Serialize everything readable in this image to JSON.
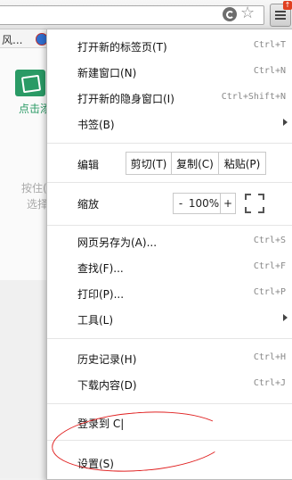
{
  "toolbar": {
    "badge": "↑"
  },
  "bookmarks": {
    "first": "风..."
  },
  "page": {
    "app_label": "点击添",
    "hint_line1": "按住(",
    "hint_line2": "选择"
  },
  "menu": {
    "new_tab": {
      "label": "打开新的标签页(T)",
      "shortcut": "Ctrl+T"
    },
    "new_window": {
      "label": "新建窗口(N)",
      "shortcut": "Ctrl+N"
    },
    "incognito": {
      "label": "打开新的隐身窗口(I)",
      "shortcut": "Ctrl+Shift+N"
    },
    "bookmarks": {
      "label": "书签(B)"
    },
    "edit": {
      "label": "编辑",
      "cut": "剪切(T)",
      "copy": "复制(C)",
      "paste": "粘贴(P)"
    },
    "zoom": {
      "label": "缩放",
      "minus": "-",
      "value": "100%",
      "plus": "+"
    },
    "save_as": {
      "label": "网页另存为(A)...",
      "shortcut": "Ctrl+S"
    },
    "find": {
      "label": "查找(F)...",
      "shortcut": "Ctrl+F"
    },
    "print": {
      "label": "打印(P)...",
      "shortcut": "Ctrl+P"
    },
    "tools": {
      "label": "工具(L)"
    },
    "history": {
      "label": "历史记录(H)",
      "shortcut": "Ctrl+H"
    },
    "downloads": {
      "label": "下载内容(D)",
      "shortcut": "Ctrl+J"
    },
    "signin": {
      "label": "登录到 C|"
    },
    "settings": {
      "label": "设置(S)"
    }
  },
  "colors": {
    "annotation": "#e02020",
    "accent_green": "#2a9a65"
  }
}
